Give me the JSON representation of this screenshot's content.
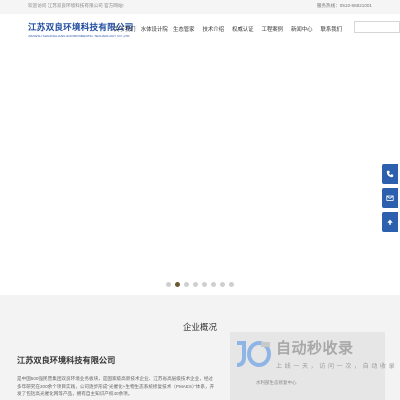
{
  "topbar": {
    "welcome": "欢迎访问 江苏双良环境科技有限公司 官方网站!",
    "hotline_label": "服务热线：",
    "hotline_number": "0510-86821001"
  },
  "logo": {
    "name_cn": "江苏双良环境科技有限公司",
    "name_en": "JIANGSU SHUANGLIANG ENVIRONMENTAL TECHNOLOGY CO.,LTD."
  },
  "nav": {
    "items": [
      {
        "label": "关于我们"
      },
      {
        "label": "水体设计院"
      },
      {
        "label": "生态管家"
      },
      {
        "label": "技术介绍"
      },
      {
        "label": "权威认证"
      },
      {
        "label": "工程案例"
      },
      {
        "label": "新闻中心"
      },
      {
        "label": "联系我们"
      }
    ]
  },
  "search": {
    "placeholder": "",
    "value": ""
  },
  "carousel": {
    "count": 8,
    "active_index": 1
  },
  "side_tools": [
    {
      "icon": "phone-icon"
    },
    {
      "icon": "mail-icon"
    },
    {
      "icon": "arrow-up-icon"
    }
  ],
  "section": {
    "title": "企业概况",
    "company_name": "江苏双良环境科技有限公司",
    "description": "是中国500强民营集团双良环境业务板块，是国家级高新技术企业、江苏省高层级技术企业，经过多年研究在200余个项目实践，公司逐步形成“光催化+生物生态系统修复技术（PMAES）”体系，开发了包括高光催化网等产品，拥有自主知识产权40余项。",
    "right_link": "水利部生态修复中心"
  },
  "watermark": {
    "title": "自动秒收录",
    "subtitle": "上 线 一 天 ， 访 问 一 次 ， 自 动 收 录"
  },
  "colors": {
    "brand": "#1d4a9e",
    "side_button": "#2c5fae",
    "dot_active": "#6b5a2f",
    "section_bg": "#f3f3f3"
  }
}
